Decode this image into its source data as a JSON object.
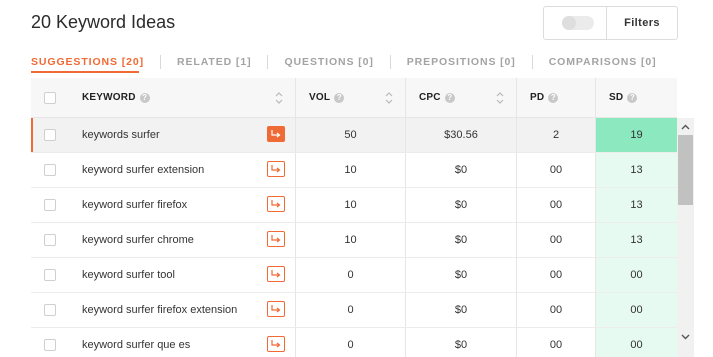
{
  "title": "20 Keyword Ideas",
  "filters": {
    "label": "Filters",
    "toggle_on": false
  },
  "tabs": [
    {
      "label": "SUGGESTIONS [20]",
      "active": true
    },
    {
      "label": "RELATED [1]",
      "active": false
    },
    {
      "label": "QUESTIONS [0]",
      "active": false
    },
    {
      "label": "PREPOSITIONS [0]",
      "active": false
    },
    {
      "label": "COMPARISONS [0]",
      "active": false
    }
  ],
  "table": {
    "headers": {
      "keyword": "KEYWORD",
      "vol": "VOL",
      "cpc": "CPC",
      "pd": "PD",
      "sd": "SD"
    },
    "rows": [
      {
        "keyword": "keywords surfer",
        "vol": "50",
        "cpc": "$30.56",
        "pd": "2",
        "sd": "19"
      },
      {
        "keyword": "keyword surfer extension",
        "vol": "10",
        "cpc": "$0",
        "pd": "00",
        "sd": "13"
      },
      {
        "keyword": "keyword surfer firefox",
        "vol": "10",
        "cpc": "$0",
        "pd": "00",
        "sd": "13"
      },
      {
        "keyword": "keyword surfer chrome",
        "vol": "10",
        "cpc": "$0",
        "pd": "00",
        "sd": "13"
      },
      {
        "keyword": "keyword surfer tool",
        "vol": "0",
        "cpc": "$0",
        "pd": "00",
        "sd": "00"
      },
      {
        "keyword": "keyword surfer firefox extension",
        "vol": "0",
        "cpc": "$0",
        "pd": "00",
        "sd": "00"
      },
      {
        "keyword": "keyword surfer que es",
        "vol": "0",
        "cpc": "$0",
        "pd": "00",
        "sd": "00"
      }
    ]
  },
  "icons": {
    "info": "info-icon",
    "sort": "sort-icon",
    "open": "external-link-icon"
  },
  "colors": {
    "accent": "#f06a35",
    "sd_strong": "#8ce8bf",
    "sd_light": "#e6faf1"
  }
}
